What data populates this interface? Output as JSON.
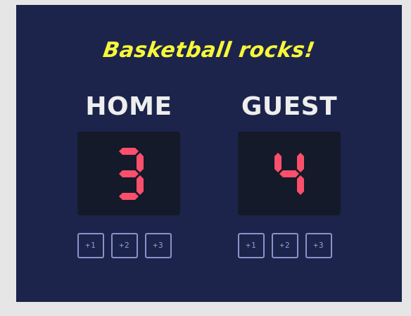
{
  "tagline": "Basketball rocks!",
  "colors": {
    "background": "#1c244b",
    "tagline": "#f7f73a",
    "team_name": "#eeeeee",
    "display_bg": "#141a2a",
    "digit": "#fb4f6b",
    "button_border": "#8b92c9"
  },
  "home": {
    "name": "HOME",
    "score": "3",
    "buttons": [
      "+1",
      "+2",
      "+3"
    ]
  },
  "guest": {
    "name": "GUEST",
    "score": "4",
    "buttons": [
      "+1",
      "+2",
      "+3"
    ]
  }
}
